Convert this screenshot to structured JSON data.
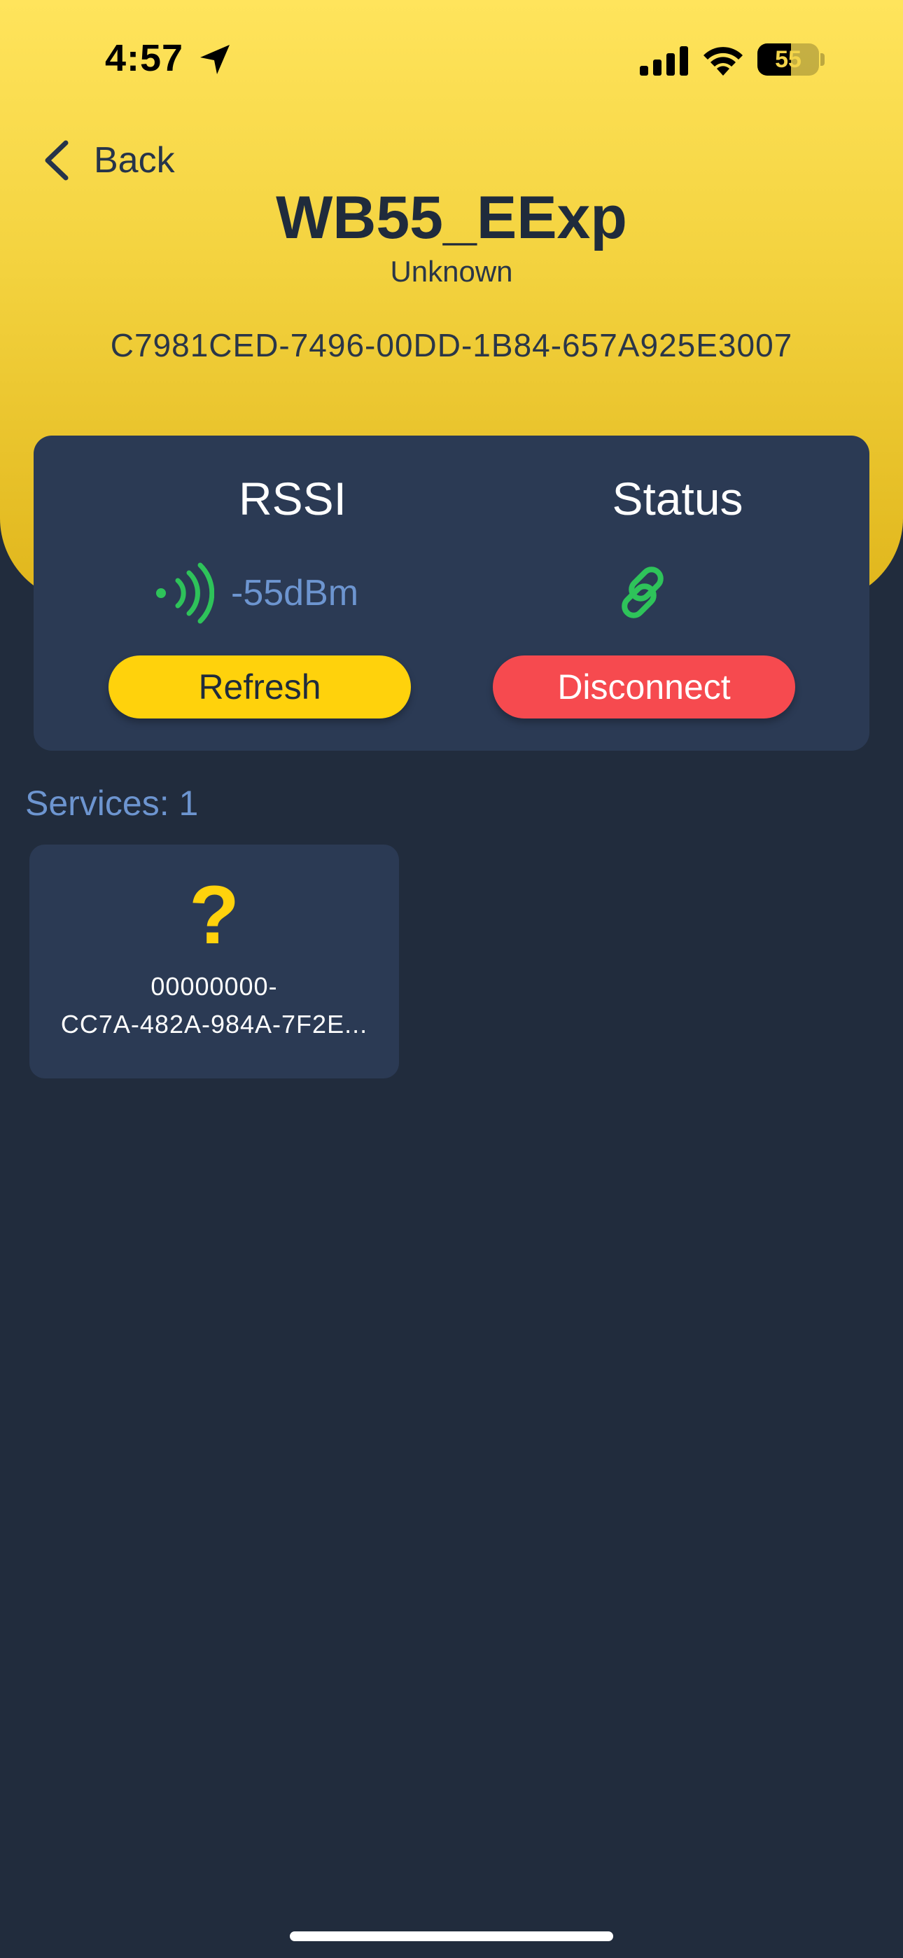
{
  "status_bar": {
    "time": "4:57",
    "battery_level": "55",
    "icons": [
      "location-arrow-icon",
      "cellular-signal-icon",
      "wifi-icon",
      "battery-icon"
    ]
  },
  "nav": {
    "back_label": "Back"
  },
  "device": {
    "name": "WB55_EExp",
    "type": "Unknown",
    "uuid": "C7981CED-7496-00DD-1B84-657A925E3007"
  },
  "info_card": {
    "rssi_title": "RSSI",
    "rssi_value": "-55dBm",
    "status_title": "Status",
    "refresh_label": "Refresh",
    "disconnect_label": "Disconnect"
  },
  "services": {
    "label": "Services: 1",
    "items": [
      {
        "icon": "?",
        "uuid": "00000000-\nCC7A-482A-984A-7F2E..."
      }
    ]
  },
  "colors": {
    "header_yellow": "#f3d23e",
    "background": "#212c3d",
    "card": "#2b3a54",
    "accent_yellow": "#ffd20c",
    "danger_red": "#f64a4f",
    "signal_green": "#2ec35a",
    "link_blue": "#6d95d0"
  }
}
